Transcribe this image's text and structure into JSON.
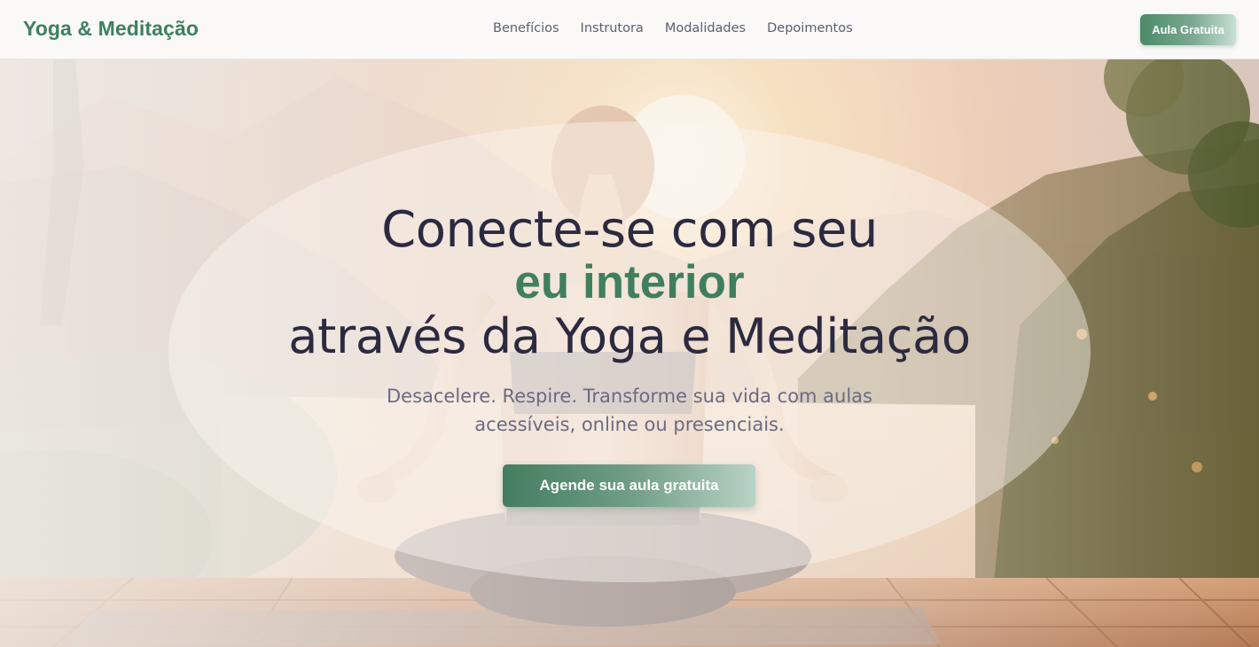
{
  "header": {
    "logo": "Yoga & Meditação",
    "nav": [
      "Benefícios",
      "Instrutora",
      "Modalidades",
      "Depoimentos"
    ],
    "cta": "Aula Gratuita"
  },
  "hero": {
    "line1": "Conecte-se com seu",
    "line2": "eu interior",
    "line3": "através da Yoga e Meditação",
    "subtitle": "Desacelere. Respire. Transforme sua vida com aulas acessíveis, online ou presenciais.",
    "cta": "Agende sua aula gratuita",
    "image": "woman-meditating-lotus-pose-sunset-lake-illustration"
  },
  "colors": {
    "brand": "#3f7f60",
    "text_dark": "#2b2a40",
    "text_muted": "#6a6b82",
    "header_bg": "#faf9f7"
  }
}
